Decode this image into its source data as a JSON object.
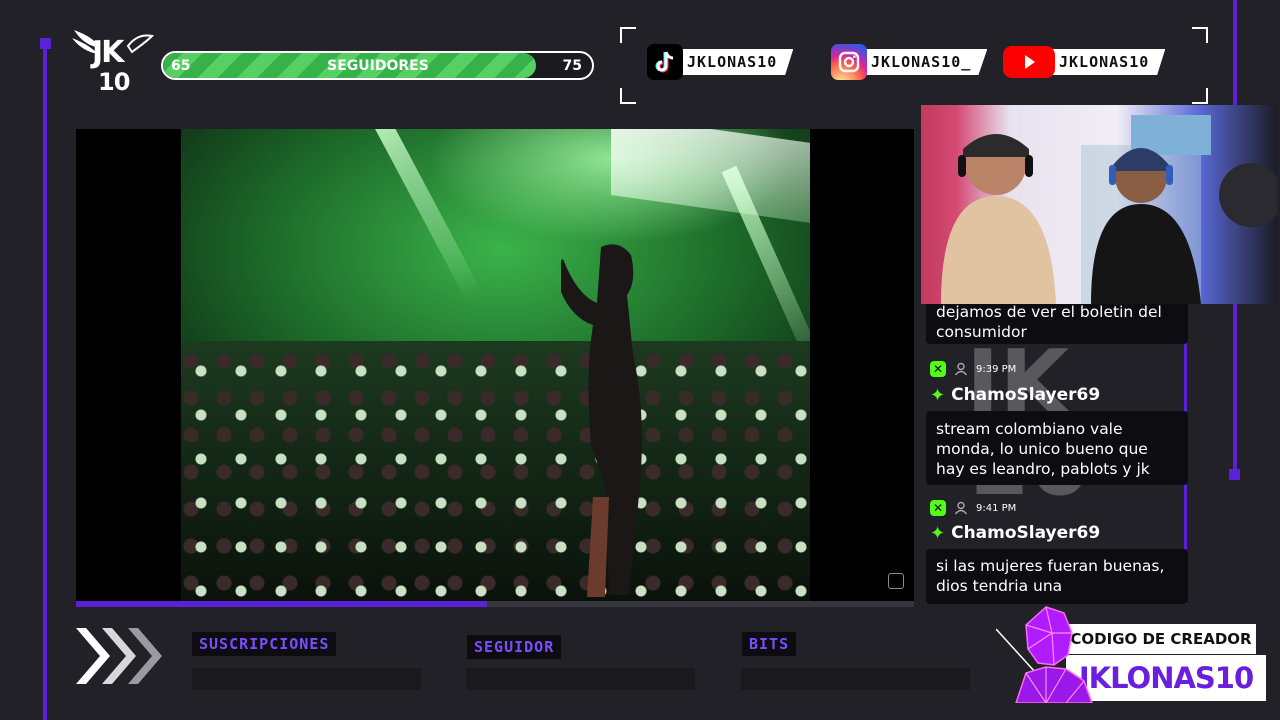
{
  "logo": {
    "line1": "JK",
    "line2": "10"
  },
  "follower_goal": {
    "title": "SEGUIDORES",
    "min": "65",
    "max": "75",
    "progress": 0.87
  },
  "socials": [
    {
      "network": "tiktok",
      "icon": "tiktok-icon",
      "handle": "JKLONAS10"
    },
    {
      "network": "instagram",
      "icon": "instagram-icon",
      "handle": "JKLONAS10_"
    },
    {
      "network": "youtube",
      "icon": "youtube-icon",
      "handle": "JKLONAS10"
    }
  ],
  "video": {
    "progress": 0.49
  },
  "chat": {
    "partial_message": "dejamos de ver el boletin del consumidor",
    "messages": [
      {
        "time": "9:39 PM",
        "user": "ChamoSlayer69",
        "text": "stream colombiano vale monda, lo unico bueno que hay es leandro, pablots y jk"
      },
      {
        "time": "9:41 PM",
        "user": "ChamoSlayer69",
        "text": "si las mujeres fueran buenas, dios tendria una"
      }
    ]
  },
  "stats": [
    {
      "label": "SUSCRIPCIONES",
      "value": ""
    },
    {
      "label": "SEGUIDOR",
      "value": ""
    },
    {
      "label": "BITS",
      "value": ""
    }
  ],
  "creator_code": {
    "title": "CODIGO DE CREADOR",
    "code": "JKLONAS10"
  },
  "colors": {
    "accent": "#5b21d6",
    "kick_green": "#53fc18",
    "goal_green": "#48c456",
    "background": "#212127"
  }
}
